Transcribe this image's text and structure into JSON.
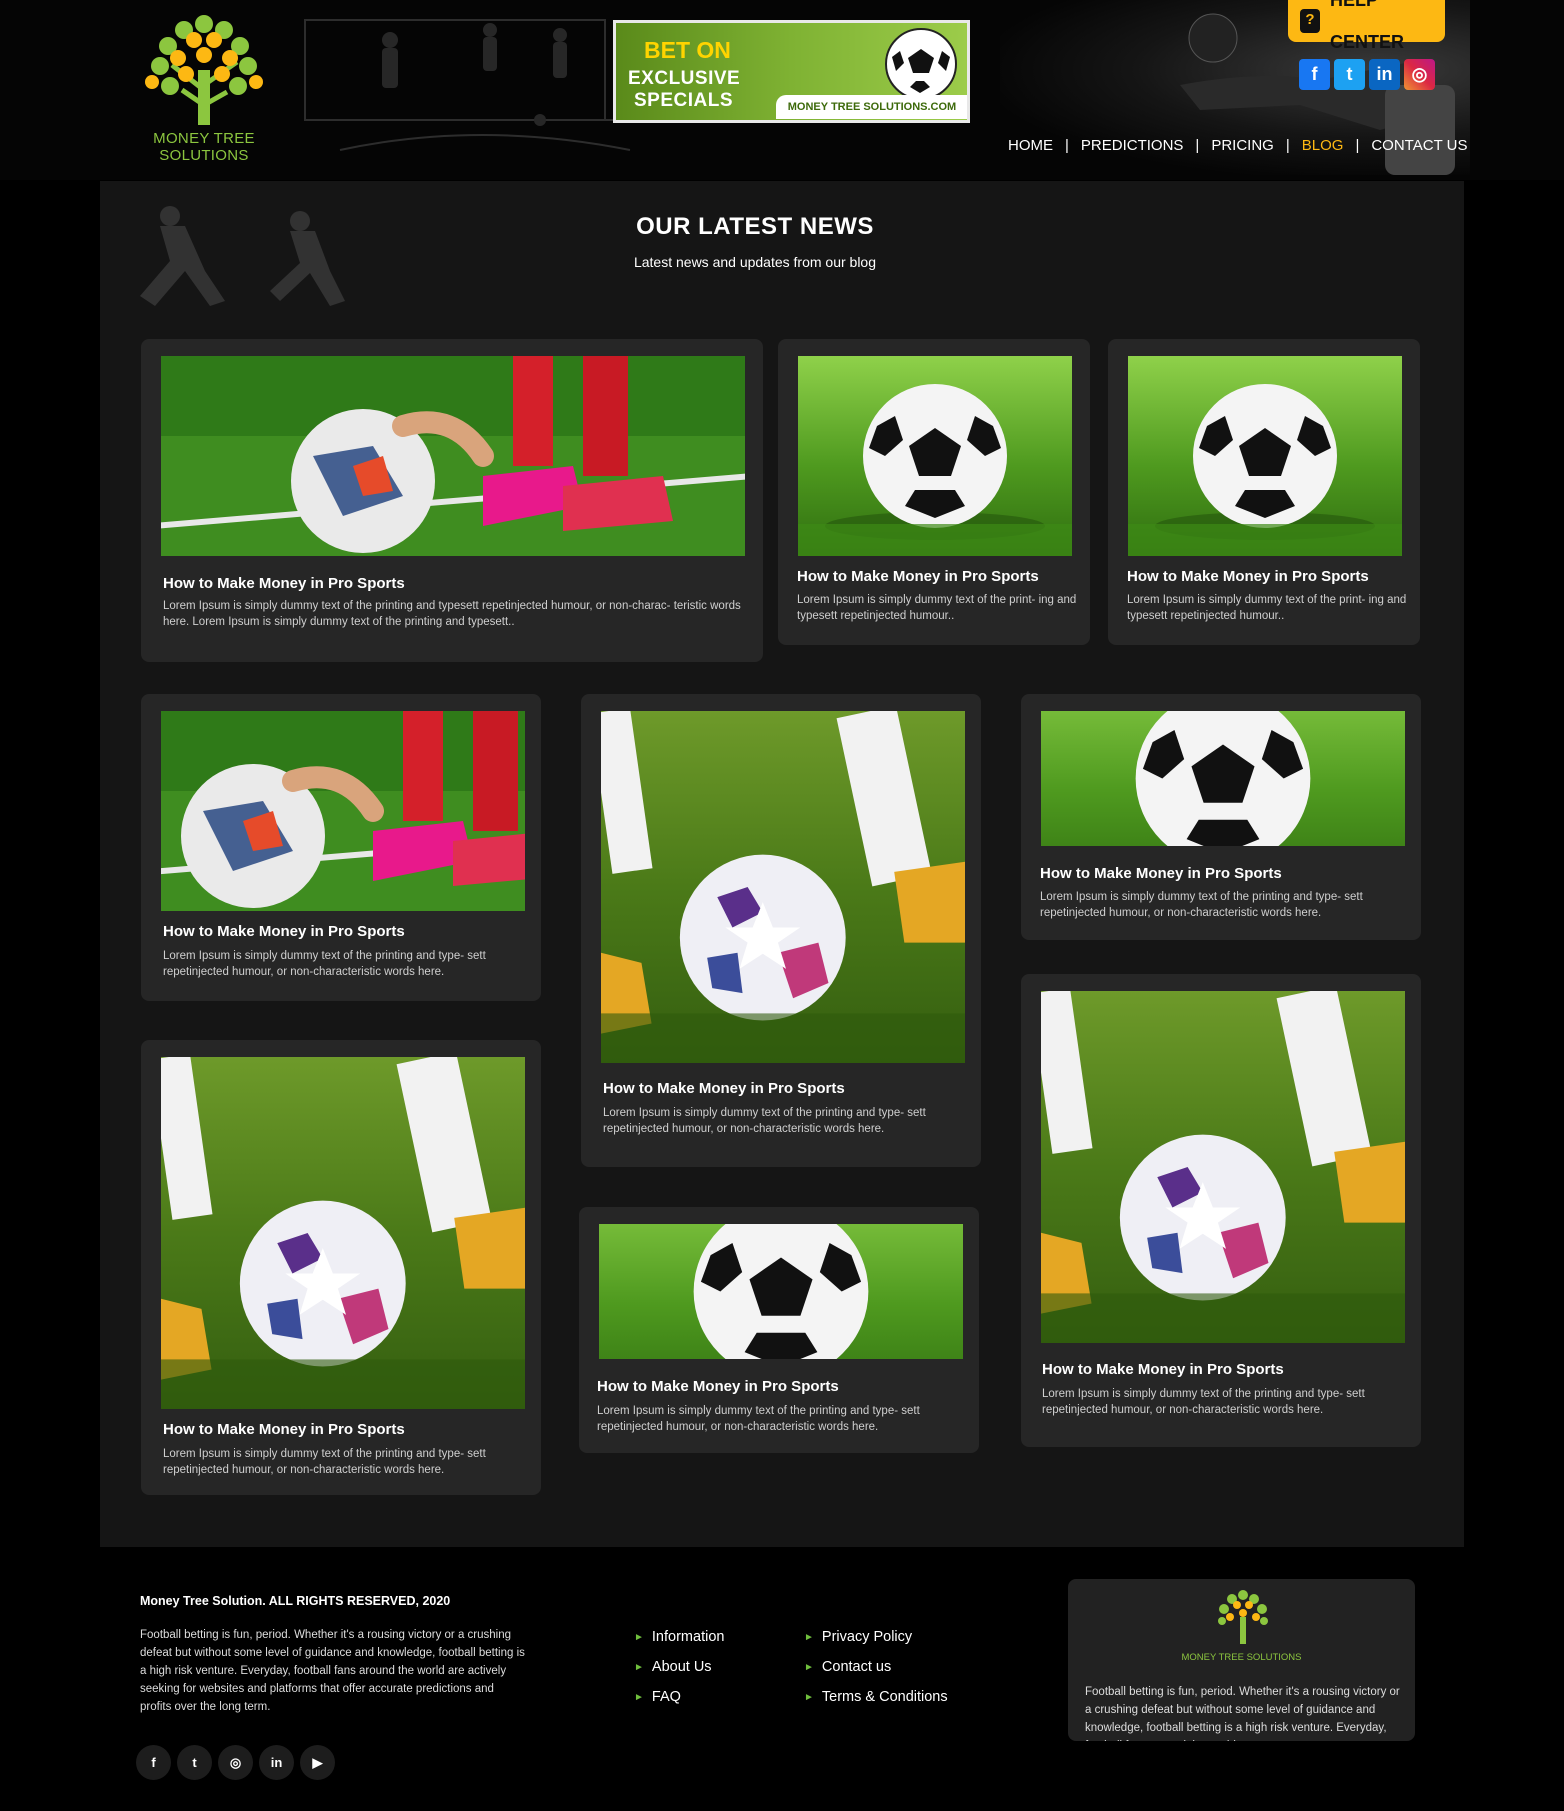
{
  "brand": {
    "name": "MONEY TREE SOLUTIONS",
    "accent": "#fdb813",
    "green": "#8cc63f"
  },
  "banner": {
    "line1": "BET ON",
    "line2": "EXCLUSIVE",
    "line3": "SPECIALS",
    "url": "MONEY TREE SOLUTIONS.COM"
  },
  "help": {
    "label": "HELP CENTER",
    "icon": "question-icon"
  },
  "social_top": [
    {
      "name": "facebook-icon",
      "glyph": "f",
      "color": "#1877f2"
    },
    {
      "name": "twitter-icon",
      "glyph": "t",
      "color": "#1da1f2"
    },
    {
      "name": "linkedin-icon",
      "glyph": "in",
      "color": "#0a66c2"
    },
    {
      "name": "instagram-icon",
      "glyph": "◎",
      "color": "#d6249f"
    }
  ],
  "nav": [
    {
      "label": "HOME",
      "active": false
    },
    {
      "label": "PREDICTIONS",
      "active": false
    },
    {
      "label": "PRICING",
      "active": false
    },
    {
      "label": "BLOG",
      "active": true
    },
    {
      "label": "CONTACT US",
      "active": false
    }
  ],
  "section": {
    "title": "OUR LATEST NEWS",
    "subtitle": "Latest news and updates from our blog"
  },
  "posts": [
    {
      "title": "How to Make Money in Pro Sports",
      "text": "Lorem Ipsum is simply dummy text of the printing and typesett repetinjected humour, or non-charac- teristic words here. Lorem Ipsum is simply dummy text of the printing and typesett..",
      "image": "ball-placing"
    },
    {
      "title": "How to Make Money in Pro Sports",
      "text": "Lorem Ipsum is simply dummy text of the print- ing and typesett repetinjected humour..",
      "image": "classic-ball"
    },
    {
      "title": "How to Make Money in Pro Sports",
      "text": "Lorem Ipsum is simply dummy text of the print- ing and typesett repetinjected humour..",
      "image": "classic-ball"
    },
    {
      "title": "How to Make Money in Pro Sports",
      "text": "Lorem Ipsum is simply dummy text of the printing and type- sett repetinjected humour, or non-characteristic words here.",
      "image": "ball-placing"
    },
    {
      "title": "How to Make Money in Pro Sports",
      "text": "Lorem Ipsum is simply dummy text of the printing and type- sett repetinjected humour, or non-characteristic words here.",
      "image": "star-ball"
    },
    {
      "title": "How to Make Money in Pro Sports",
      "text": "Lorem Ipsum is simply dummy text of the printing and type- sett repetinjected humour, or non-characteristic words here.",
      "image": "classic-ball"
    },
    {
      "title": "How to Make Money in Pro Sports",
      "text": "Lorem Ipsum is simply dummy text of the printing and type- sett repetinjected humour, or non-characteristic words here.",
      "image": "star-ball"
    },
    {
      "title": "How to Make Money in Pro Sports",
      "text": "Lorem Ipsum is simply dummy text of the printing and type- sett repetinjected humour, or non-characteristic words here.",
      "image": "classic-ball"
    },
    {
      "title": "How to Make Money in Pro Sports",
      "text": "Lorem Ipsum is simply dummy text of the printing and type- sett repetinjected humour, or non-characteristic words here.",
      "image": "star-ball"
    }
  ],
  "footer": {
    "copyright": "Money Tree Solution. ALL RIGHTS RESERVED, 2020",
    "about": "Football betting is fun, period. Whether it's a rousing victory or a crushing defeat but without some level of guidance and knowledge, football betting is a high risk venture. Everyday, football fans around the world are actively seeking for websites and platforms that offer accurate predictions and profits over the long term.",
    "links_col1": [
      "Information",
      "About Us",
      "FAQ"
    ],
    "links_col2": [
      "Privacy Policy",
      "Contact us",
      "Terms & Conditions"
    ],
    "social": [
      {
        "name": "facebook-icon",
        "glyph": "f"
      },
      {
        "name": "twitter-icon",
        "glyph": "t"
      },
      {
        "name": "instagram-icon",
        "glyph": "◎"
      },
      {
        "name": "linkedin-icon",
        "glyph": "in"
      },
      {
        "name": "youtube-icon",
        "glyph": "▶"
      }
    ],
    "box_logo_text": "MONEY TREE SOLUTIONS",
    "box_text": "Football betting is fun, period. Whether it's a rousing victory or a crushing defeat but without some level of guidance and knowledge, football betting is a high risk venture. Everyday, football fans around the world"
  }
}
